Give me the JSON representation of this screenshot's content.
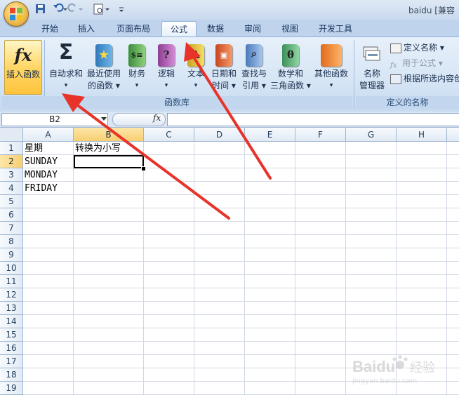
{
  "window": {
    "title": "baidu  [兼容"
  },
  "tabs": [
    {
      "label": "开始",
      "active": false
    },
    {
      "label": "插入",
      "active": false
    },
    {
      "label": "页面布局",
      "active": false
    },
    {
      "label": "公式",
      "active": true
    },
    {
      "label": "数据",
      "active": false
    },
    {
      "label": "审阅",
      "active": false
    },
    {
      "label": "视图",
      "active": false
    },
    {
      "label": "开发工具",
      "active": false
    }
  ],
  "ribbon": {
    "insert_function": {
      "icon": "fx",
      "label": "插入函数"
    },
    "autosum": {
      "icon": "Σ",
      "line1": "自动求和",
      "line2": "▾"
    },
    "recent": {
      "line1": "最近使用",
      "line2": "的函数 ▾"
    },
    "finance": {
      "line1": "财务",
      "line2": "▾"
    },
    "logic": {
      "line1": "逻辑",
      "line2": "▾"
    },
    "text": {
      "line1": "文本",
      "line2": "▾"
    },
    "datetime": {
      "line1": "日期和",
      "line2": "时间 ▾"
    },
    "lookup": {
      "line1": "查找与",
      "line2": "引用 ▾"
    },
    "math": {
      "line1": "数学和",
      "line2": "三角函数 ▾"
    },
    "other": {
      "line1": "其他函数",
      "line2": "▾"
    },
    "library_label": "函数库",
    "name_manager": {
      "line1": "名称",
      "line2": "管理器"
    },
    "define_name": "定义名称 ▾",
    "use_in_formula": "用于公式 ▾",
    "create_from_selection": "根据所选内容创",
    "defined_names_label": "定义的名称"
  },
  "formula_bar": {
    "name_box": "B2",
    "fx": "fx",
    "content": ""
  },
  "sheet": {
    "columns": [
      "A",
      "B",
      "C",
      "D",
      "E",
      "F",
      "G",
      "H"
    ],
    "rows": [
      "1",
      "2",
      "3",
      "4",
      "5",
      "6",
      "7",
      "8",
      "9",
      "10",
      "11",
      "12",
      "13",
      "14",
      "15",
      "16",
      "17",
      "18",
      "19"
    ],
    "cells": {
      "A1": "星期",
      "B1": "转换为小写",
      "A2": "SUNDAY",
      "A3": "MONDAY",
      "A4": "FRIDAY"
    },
    "active_cell": "B2"
  },
  "colors": {
    "accent": "#f0b94a",
    "arrow": "#e8332a",
    "ribbon": "#d6e5f5"
  },
  "watermark": {
    "brand": "Baidu",
    "cn": "经验",
    "url": "jingyan.baidu.com"
  }
}
